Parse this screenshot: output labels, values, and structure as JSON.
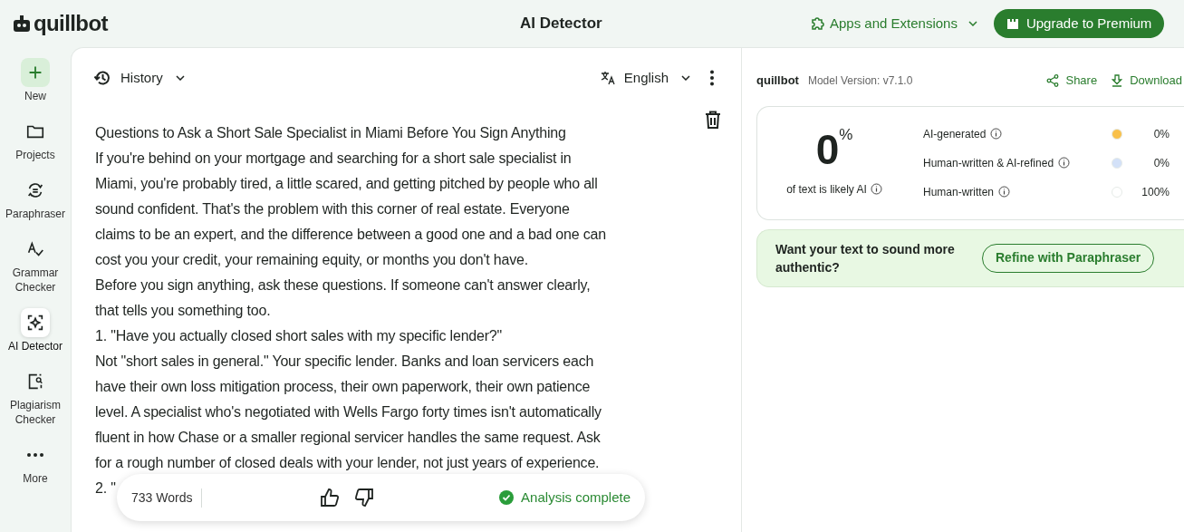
{
  "header": {
    "logo": "quillbot",
    "title": "AI Detector",
    "apps_link": "Apps and Extensions",
    "upgrade_button": "Upgrade to Premium"
  },
  "sidebar": {
    "items": [
      {
        "kind": "new",
        "label": "New",
        "selected": false
      },
      {
        "kind": "folder",
        "label": "Projects",
        "selected": false
      },
      {
        "kind": "paraphrase",
        "label": "Paraphraser",
        "selected": false
      },
      {
        "kind": "grammar",
        "label": "Grammar Checker",
        "selected": false
      },
      {
        "kind": "detector",
        "label": "AI Detector",
        "selected": true
      },
      {
        "kind": "plagiarism",
        "label": "Plagiarism Checker",
        "selected": false
      },
      {
        "kind": "more",
        "label": "More",
        "selected": false
      }
    ]
  },
  "editor": {
    "history": "History",
    "language": "English",
    "lines": [
      "Questions to Ask a Short Sale Specialist in Miami Before You Sign Anything",
      "If you're behind on your mortgage and searching for a short sale specialist in",
      "Miami, you're probably tired, a little scared, and getting pitched by people who all",
      "sound confident. That's the problem with this corner of real estate. Everyone",
      "claims to be an expert, and the difference between a good one and a bad one can",
      "cost you your credit, your remaining equity, or months you don't have.",
      "Before you sign anything, ask these questions. If someone can't answer clearly,",
      "that tells you something too.",
      "1. \"Have you actually closed short sales with my specific lender?\"",
      "Not \"short sales in general.\" Your specific lender. Banks and loan servicers each",
      "have their own loss mitigation process, their own paperwork, their own patience",
      "level. A specialist who's negotiated with Wells Fargo forty times isn't automatically",
      "fluent in how Chase or a smaller regional servicer handles the same request. Ask",
      "for a rough number of closed deals with your lender, not just years of experience.",
      "2. \""
    ],
    "status_bar": {
      "word_count": "733 Words",
      "status": "Analysis complete"
    }
  },
  "results": {
    "logo": "quillbot",
    "model_version": "Model Version: v7.1.0",
    "share": "Share",
    "download": "Download",
    "score": "0",
    "score_unit": "%",
    "score_caption": "of text is likely AI",
    "breakdown": [
      {
        "label": "AI-generated",
        "color": "#f9c04a",
        "value": "0%"
      },
      {
        "label": "Human-written & AI-refined",
        "color": "#d3e1f8",
        "value": "0%"
      },
      {
        "label": "Human-written",
        "color": "#ffffff",
        "value": "100%"
      }
    ],
    "promo": {
      "text": "Want your text to sound more authentic?",
      "button": "Refine with Paraphraser"
    }
  }
}
